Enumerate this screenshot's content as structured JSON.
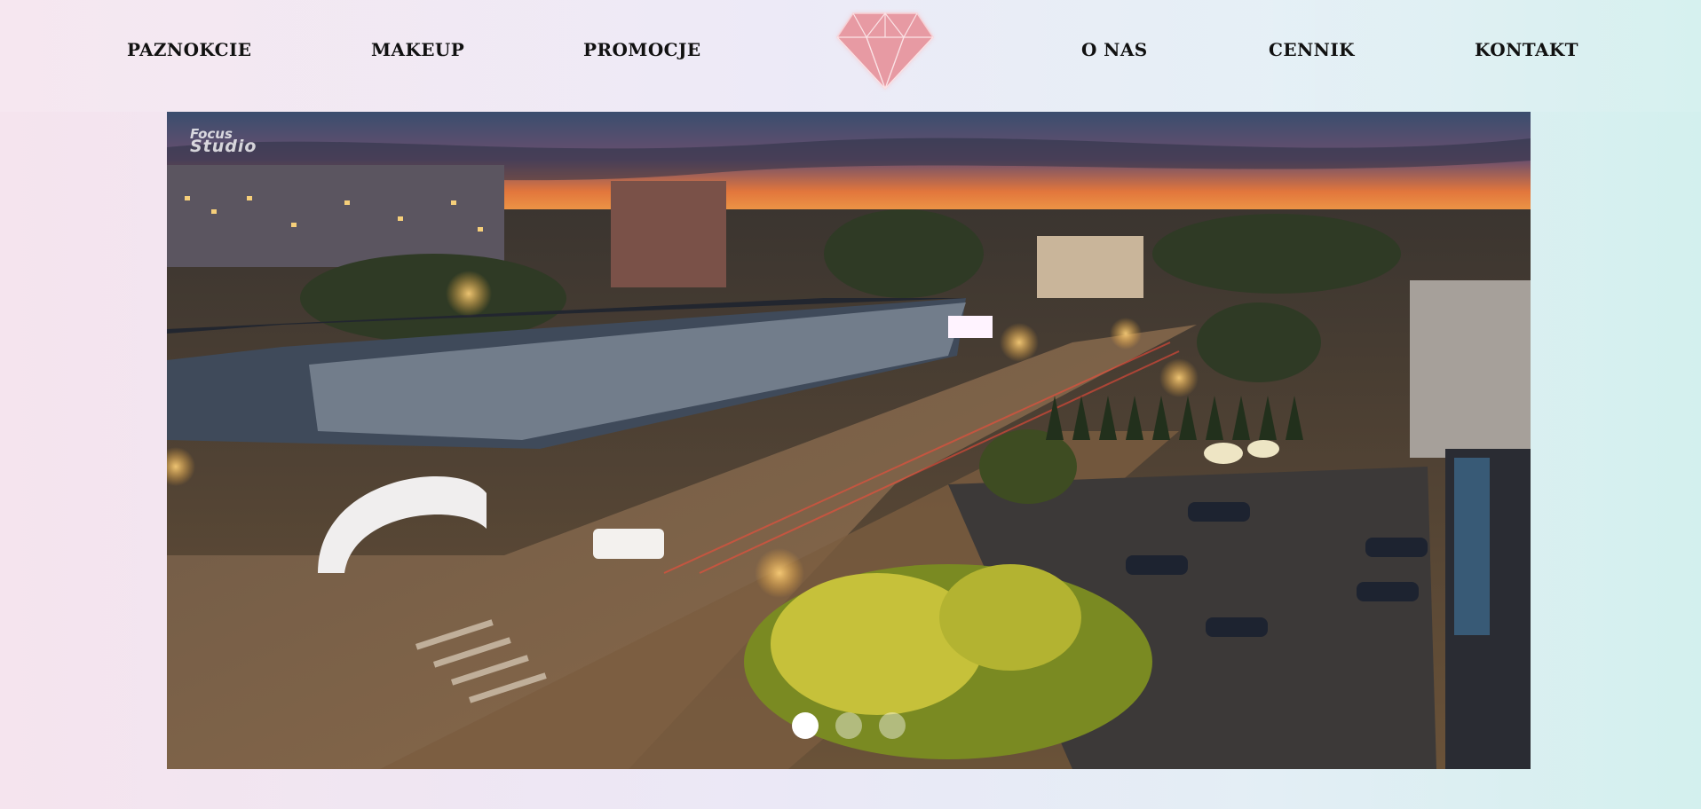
{
  "nav": {
    "left": [
      {
        "label": "PAZNOKCIE"
      },
      {
        "label": "MAKEUP"
      },
      {
        "label": "PROMOCJE"
      }
    ],
    "right": [
      {
        "label": "O NAS"
      },
      {
        "label": "CENNIK"
      },
      {
        "label": "KONTAKT"
      }
    ],
    "logo_icon": "diamond-icon",
    "logo_color": "#e79aa3"
  },
  "hero": {
    "watermark_line1": "Focus",
    "watermark_line2": "Studio",
    "slides_total": 3,
    "active_slide": 1
  },
  "colors": {
    "text": "#111111",
    "dot_active": "#ffffff"
  }
}
